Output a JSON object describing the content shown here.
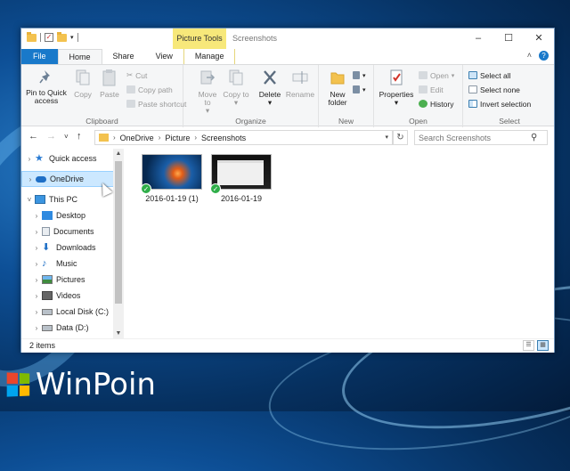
{
  "window": {
    "title": "Screenshots",
    "context_tab": "Picture Tools",
    "controls": [
      "–",
      "☐",
      "✕"
    ]
  },
  "tabs": {
    "file": "File",
    "home": "Home",
    "share": "Share",
    "view": "View",
    "manage": "Manage"
  },
  "ribbon": {
    "clipboard": {
      "label": "Clipboard",
      "pin": "Pin to Quick access",
      "copy": "Copy",
      "paste": "Paste",
      "cut": "Cut",
      "copy_path": "Copy path",
      "paste_shortcut": "Paste shortcut"
    },
    "organize": {
      "label": "Organize",
      "move_to": "Move to",
      "copy_to": "Copy to",
      "delete": "Delete",
      "rename": "Rename"
    },
    "new": {
      "label": "New",
      "new_folder": "New folder"
    },
    "open": {
      "label": "Open",
      "properties": "Properties",
      "open": "Open",
      "edit": "Edit",
      "history": "History"
    },
    "select": {
      "label": "Select",
      "select_all": "Select all",
      "select_none": "Select none",
      "invert_selection": "Invert selection"
    }
  },
  "address": {
    "crumbs": [
      "OneDrive",
      "Picture",
      "Screenshots"
    ],
    "search_placeholder": "Search Screenshots"
  },
  "navpane": {
    "items": [
      {
        "label": "Quick access",
        "icon": "star-icon"
      },
      {
        "label": "OneDrive",
        "icon": "cloud-icon"
      },
      {
        "label": "This PC",
        "icon": "monitor-icon"
      },
      {
        "label": "Desktop",
        "icon": "desktop-icon"
      },
      {
        "label": "Documents",
        "icon": "documents-icon"
      },
      {
        "label": "Downloads",
        "icon": "downloads-icon"
      },
      {
        "label": "Music",
        "icon": "music-icon"
      },
      {
        "label": "Pictures",
        "icon": "pictures-icon"
      },
      {
        "label": "Videos",
        "icon": "videos-icon"
      },
      {
        "label": "Local Disk (C:)",
        "icon": "drive-c-icon"
      },
      {
        "label": "Data (D:)",
        "icon": "drive-d-icon"
      }
    ]
  },
  "files": [
    {
      "name": "2016-01-19 (1)"
    },
    {
      "name": "2016-01-19"
    }
  ],
  "status": {
    "count": "2 items"
  },
  "watermark": {
    "text": "WinPoin",
    "colors": [
      "#e9462c",
      "#7fba00",
      "#00a4ef",
      "#ffb900"
    ]
  },
  "colors": {
    "accent": "#1979ca",
    "context_tab": "#f7e87a",
    "selection": "#cce8ff"
  }
}
